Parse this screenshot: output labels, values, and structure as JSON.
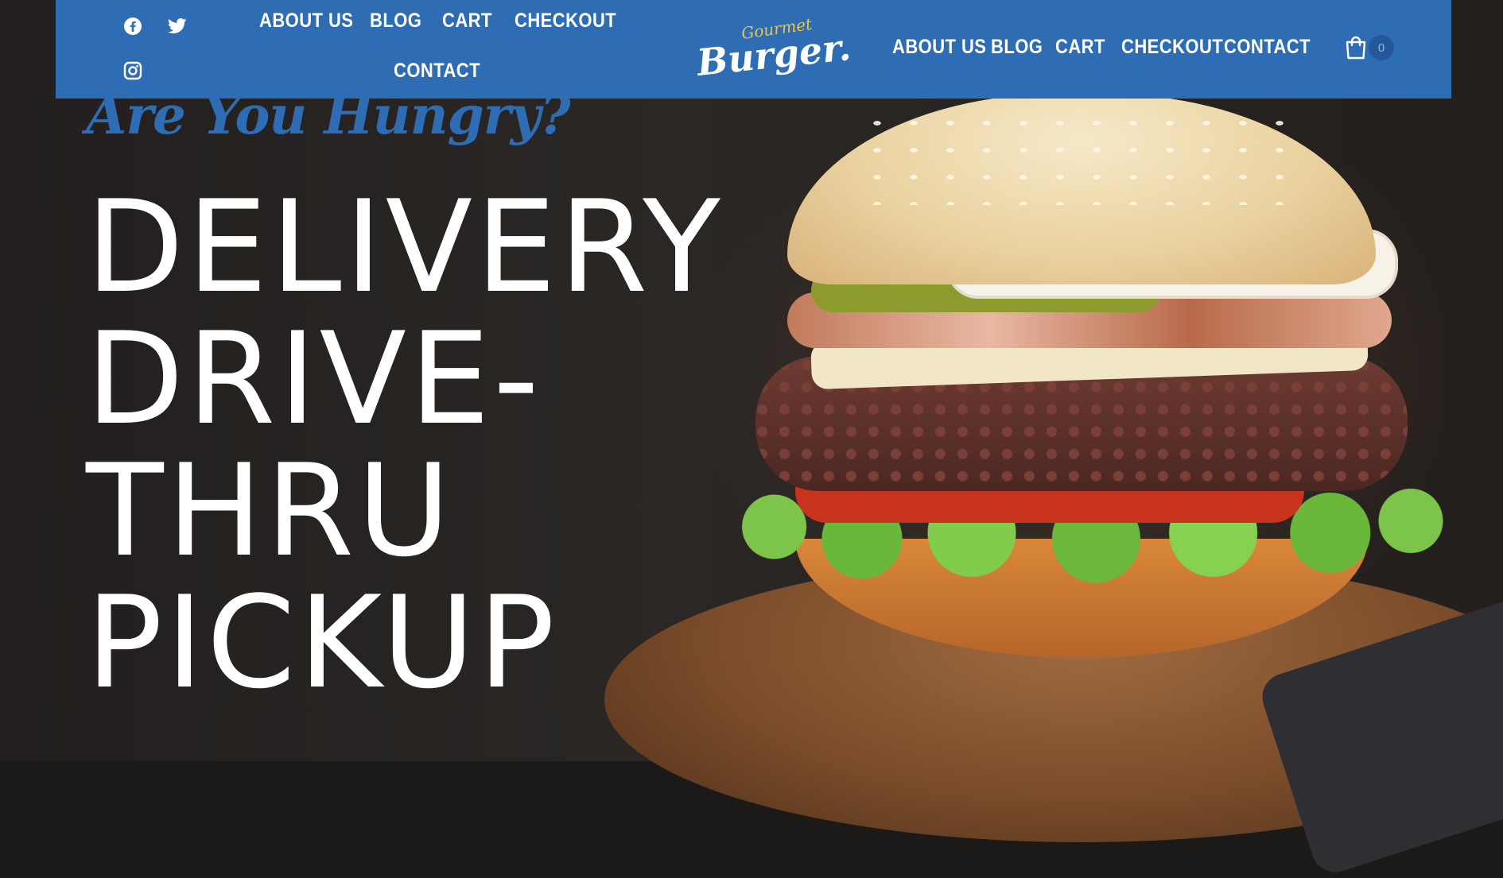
{
  "header": {
    "left_nav": [
      {
        "label": "ABOUT US"
      },
      {
        "label": "BLOG"
      },
      {
        "label": "CART"
      },
      {
        "label": "CHECKOUT"
      },
      {
        "label": "CONTACT"
      }
    ],
    "right_nav": [
      {
        "label": "ABOUT US"
      },
      {
        "label": "BLOG"
      },
      {
        "label": "CART"
      },
      {
        "label": "CHECKOUT"
      },
      {
        "label": "CONTACT"
      }
    ],
    "social": [
      {
        "icon": "facebook-icon"
      },
      {
        "icon": "twitter-icon"
      },
      {
        "icon": "instagram-icon"
      }
    ],
    "logo": {
      "top": "Gourmet",
      "main": "Burger."
    },
    "cart_count": "0"
  },
  "hero": {
    "tagline": "Are You Hungry?",
    "headline_lines": [
      "DELIVERY",
      "DRIVE-",
      "THRU",
      "PICKUP"
    ]
  },
  "colors": {
    "header_bg": "#2e6db4",
    "logo_accent": "#f0c345",
    "headline": "#ffffff",
    "tagline": "#2e6db4"
  }
}
